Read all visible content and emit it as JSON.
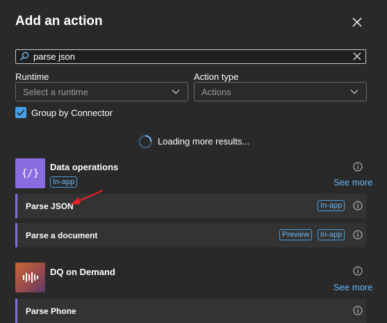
{
  "header": {
    "title": "Add an action"
  },
  "search": {
    "value": "parse json"
  },
  "filters": {
    "runtime_label": "Runtime",
    "runtime_placeholder": "Select a runtime",
    "action_type_label": "Action type",
    "action_type_placeholder": "Actions"
  },
  "group_by": {
    "label": "Group by Connector",
    "checked": true
  },
  "loading": {
    "text": "Loading more results..."
  },
  "connectors": [
    {
      "name": "Data operations",
      "badge": "In-app",
      "see_more": "See more",
      "icon": "data-operations-icon",
      "color": "#8b6ce0",
      "actions": [
        {
          "name": "Parse JSON",
          "badges": [
            "In-app"
          ]
        },
        {
          "name": "Parse a document",
          "badges": [
            "Preview",
            "In-app"
          ]
        }
      ]
    },
    {
      "name": "DQ on Demand",
      "see_more": "See more",
      "icon": "audio-bars-icon",
      "color": "#c8663a",
      "actions": [
        {
          "name": "Parse Phone",
          "badges": []
        }
      ]
    }
  ],
  "colors": {
    "background": "#292929",
    "accent": "#4aa0e6",
    "link": "#6cb8f6",
    "action_stripe": "#8b6ce0",
    "annotation_arrow": "#e8202a"
  }
}
